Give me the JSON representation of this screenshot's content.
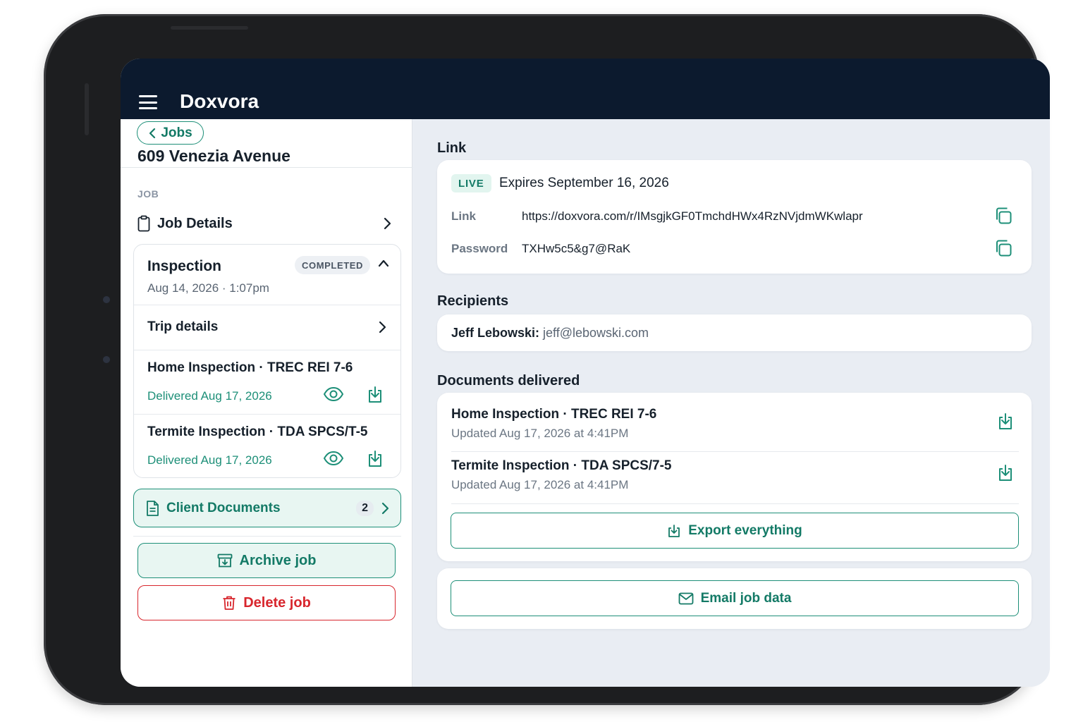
{
  "app": {
    "title": "Doxvora"
  },
  "back": {
    "label": "Jobs"
  },
  "job": {
    "address": "609 Venezia Avenue"
  },
  "sidebar": {
    "section_label": "JOB",
    "job_details_label": "Job Details",
    "inspection": {
      "title": "Inspection",
      "status": "COMPLETED",
      "datetime": "Aug 14, 2026 · 1:07pm",
      "trip_label": "Trip details",
      "documents": [
        {
          "title": "Home Inspection · TREC REI 7-6",
          "status": "Delivered Aug 17, 2026"
        },
        {
          "title": "Termite Inspection · TDA SPCS/T-5",
          "status": "Delivered Aug 17, 2026"
        }
      ]
    },
    "client_documents": {
      "label": "Client Documents",
      "count": "2"
    },
    "archive_label": "Archive job",
    "delete_label": "Delete job"
  },
  "link_section": {
    "label": "Link",
    "badge": "LIVE",
    "expires": "Expires September 16, 2026",
    "link_key": "Link",
    "link_value": "https://doxvora.com/r/IMsgjkGF0TmchdHWx4RzNVjdmWKwlapr",
    "password_key": "Password",
    "password_value": "TXHw5c5&g7@RaK"
  },
  "recipients": {
    "label": "Recipients",
    "items": [
      {
        "name": "Jeff Lebowski:",
        "email": "jeff@lebowski.com"
      }
    ]
  },
  "documents_delivered": {
    "label": "Documents delivered",
    "items": [
      {
        "title": "Home Inspection · TREC REI 7-6",
        "updated": "Updated Aug 17, 2026 at 4:41PM"
      },
      {
        "title": "Termite Inspection · TDA SPCS/7-5",
        "updated": "Updated Aug 17, 2026 at 4:41PM"
      }
    ],
    "export_label": "Export everything"
  },
  "email": {
    "label": "Email job data"
  },
  "colors": {
    "accent": "#1d8f78",
    "danger": "#d8262d",
    "header": "#0c1a2e",
    "background": "#e9edf3"
  },
  "icons": [
    "menu-icon",
    "chevron-left-icon",
    "clipboard-icon",
    "chevron-right-icon",
    "chevron-up-icon",
    "eye-icon",
    "download-icon",
    "document-icon",
    "archive-icon",
    "trash-icon",
    "copy-icon",
    "export-icon",
    "mail-icon"
  ]
}
